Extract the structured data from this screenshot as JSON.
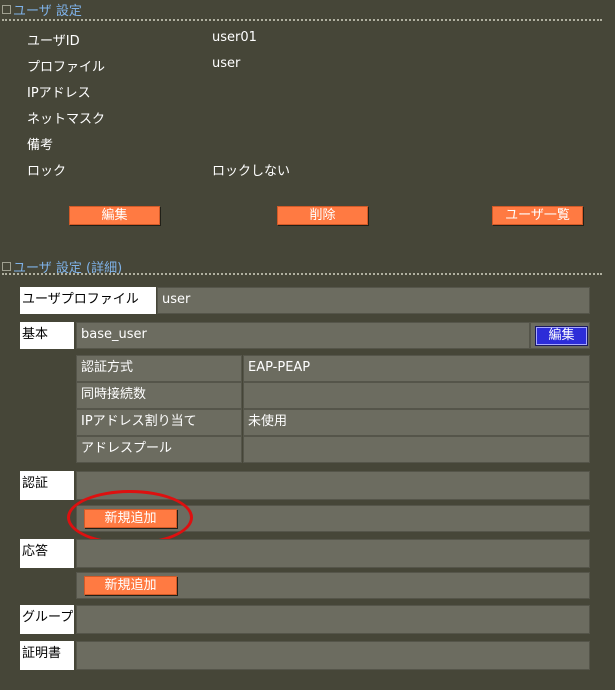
{
  "user_settings": {
    "title": "ユーザ 設定",
    "rows": [
      {
        "label": "ユーザID",
        "value": "user01"
      },
      {
        "label": "プロファイル",
        "value": "user"
      },
      {
        "label": "IPアドレス",
        "value": ""
      },
      {
        "label": "ネットマスク",
        "value": ""
      },
      {
        "label": "備考",
        "value": ""
      },
      {
        "label": "ロック",
        "value": "ロックしない"
      }
    ],
    "buttons": {
      "edit": "編集",
      "delete": "削除",
      "list": "ユーザ一覧"
    }
  },
  "detail": {
    "title": "ユーザ 設定 (詳細)",
    "user_profile_label": "ユーザプロファイル",
    "user_profile_value": "user",
    "basic_label": "基本",
    "basic_value": "base_user",
    "basic_edit": "編集",
    "basic_rows": [
      {
        "label": "認証方式",
        "value": "EAP-PEAP"
      },
      {
        "label": "同時接続数",
        "value": ""
      },
      {
        "label": "IPアドレス割り当て",
        "value": "未使用"
      },
      {
        "label": "アドレスプール",
        "value": ""
      }
    ],
    "auth_label": "認証",
    "auth_add": "新規追加",
    "reply_label": "応答",
    "reply_add": "新規追加",
    "group_label": "グループ",
    "cert_label": "証明書"
  },
  "annotation_color": "#dd1010"
}
